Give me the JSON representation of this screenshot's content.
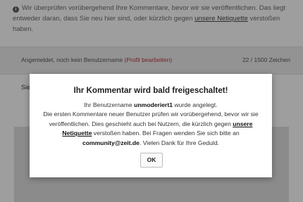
{
  "notice": {
    "icon": "info-icon",
    "text_before": "Wir überprüfen vorübergehend Ihre Kommentare, bevor wir sie veröffentlichen. Das liegt entweder daran, dass Sie neu hier sind, oder kürzlich gegen ",
    "link": "unsere Netiquette",
    "text_after": " verstoßen haben."
  },
  "comment_form": {
    "logged_in_text": "Angemeldet, noch kein Benutzername",
    "profile_link": "(Profil bearbeiten)",
    "char_count": "22 / 1500 Zeichen",
    "partial_text": "Sie"
  },
  "modal": {
    "title": "Ihr Kommentar wird bald freigeschaltet!",
    "line1_before": "Ihr Benutzername ",
    "username": "unmoderiert1",
    "line1_after": " wurde angelegt.",
    "line2": "Die ersten Kommentare neuer Benutzer prüfen wir vorübergehend, bevor wir sie veröffentlichen. Dies geschieht auch bei Nutzern, die kürzlich gegen ",
    "netiquette_link": "unsere Netiquette",
    "line3": " verstoßen haben. Bei Fragen wenden Sie sich bitte an ",
    "email": "community@zeit.de",
    "line4": ". Vielen Dank für Ihre Geduld.",
    "ok_label": "OK"
  },
  "colors": {
    "link_red": "#b5202a",
    "overlay": "rgba(40,40,40,0.45)"
  }
}
